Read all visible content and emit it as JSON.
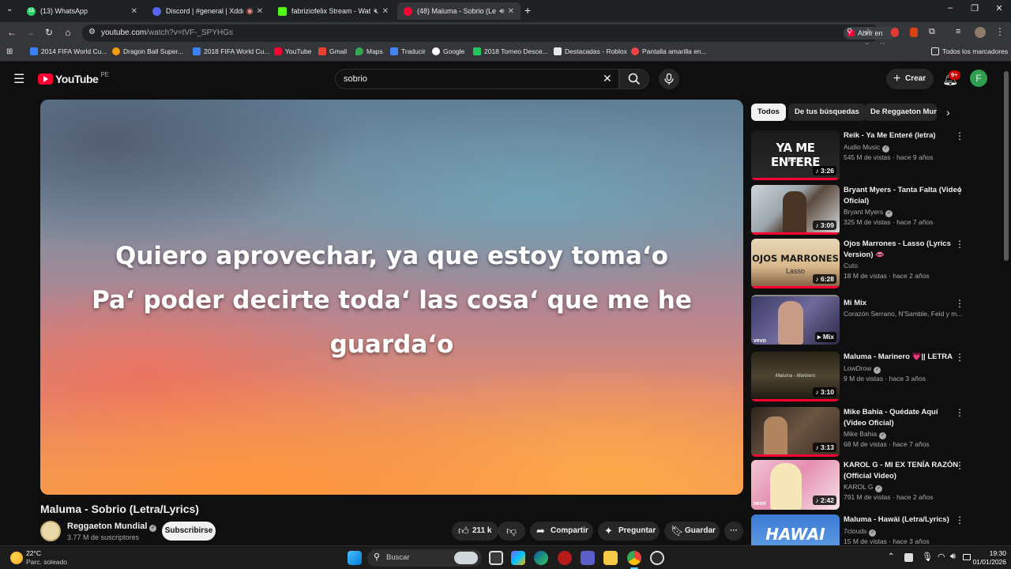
{
  "browser": {
    "tabs": [
      {
        "title": "(13) WhatsApp",
        "badge": "13"
      },
      {
        "title": "Discord | #general | Xddd"
      },
      {
        "title": "fabriziofelix Stream - Watch"
      },
      {
        "title": "(48) Maluma - Sobrio (Letra)"
      }
    ],
    "url_host": "youtube.com",
    "url_path": "/watch?v=tVF-_SPYHGs",
    "open_app_label": "Abrir en aplicación",
    "bookmarks": [
      "2014 FIFA World Cu...",
      "Dragon Ball Super...",
      "2018 FIFA World Cu...",
      "YouTube",
      "Gmail",
      "Maps",
      "Traducir",
      "Google",
      "2018 Torneo Desce...",
      "Destacadas - Roblox",
      "Pantalla amarilla en..."
    ],
    "all_bookmarks_label": "Todos los marcadores"
  },
  "youtube": {
    "logo_text": "YouTube",
    "region": "PE",
    "search_value": "sobrio",
    "create_label": "Crear",
    "notif_badge": "9+",
    "avatar_letter": "F"
  },
  "video": {
    "lyrics": [
      "Quiero aprovechar, ya que estoy toma‘o",
      "Pa‘ poder decirte toda‘ las cosa‘ que me he",
      "guarda‘o"
    ],
    "title": "Maluma - Sobrio (Letra/Lyrics)",
    "channel": "Reggaeton Mundial",
    "subscribers": "3.77 M de suscriptores",
    "subscribe_label": "Subscribirse",
    "likes": "211 k",
    "share_label": "Compartir",
    "ask_label": "Preguntar",
    "save_label": "Guardar"
  },
  "sidebar": {
    "chips": [
      "Todos",
      "De tus búsquedas",
      "De Reggaeton Mundial"
    ],
    "recommendations": [
      {
        "title": "Reik - Ya Me Enteré (letra)",
        "channel": "Audio Music",
        "verified": true,
        "stats": "545 M de vistas · hace 9 años",
        "duration": "3:26",
        "thumb_text": "YA ME ENTERE",
        "thumb_sub": "REIK"
      },
      {
        "title": "Bryant Myers - Tanta Falta (Video Oficial)",
        "channel": "Bryant Myers",
        "verified": true,
        "stats": "325 M de vistas · hace 7 años",
        "duration": "3:09"
      },
      {
        "title": "Ojos Marrones - Lasso (Lyrics Version) 👄",
        "channel": "Cuto",
        "verified": false,
        "stats": "18 M de vistas · hace 2 años",
        "duration": "6:28",
        "thumb_text": "OJOS MARRONES",
        "thumb_sub": "Lasso"
      },
      {
        "title": "Mi Mix",
        "channel": "Corazón Serrano, N'Samble, Feid y m...",
        "verified": false,
        "stats": "",
        "duration": "Mix"
      },
      {
        "title": "Maluma - Marinero 💗|| LETRA",
        "channel": "LowDrow",
        "verified": true,
        "stats": "9 M de vistas · hace 3 años",
        "duration": "3:10",
        "thumb_sub": "Maluma - Marinero"
      },
      {
        "title": "Mike Bahia - Quédate Aquí (Video Oficial)",
        "channel": "Mike Bahia",
        "verified": true,
        "stats": "68 M de vistas · hace 7 años",
        "duration": "3:13"
      },
      {
        "title": "KAROL G - MI EX TENÍA RAZÓN (Official Video)",
        "channel": "KAROL G",
        "verified": true,
        "stats": "791 M de vistas · hace 2 años",
        "duration": "2:42"
      },
      {
        "title": "Maluma - Hawái (Letra/Lyrics)",
        "channel": "7clouds",
        "verified": true,
        "stats": "15 M de vistas · hace 3 años",
        "duration": "",
        "thumb_text": "HAWAI"
      }
    ]
  },
  "taskbar": {
    "weather_temp": "22°C",
    "weather_desc": "Parc. soleado",
    "search_label": "Buscar",
    "time": "19:30",
    "date": "01/01/2026"
  },
  "colors": {
    "yt_red": "#ff0033",
    "bg": "#0f0f0f",
    "chip_active": "#f1f1f1"
  }
}
